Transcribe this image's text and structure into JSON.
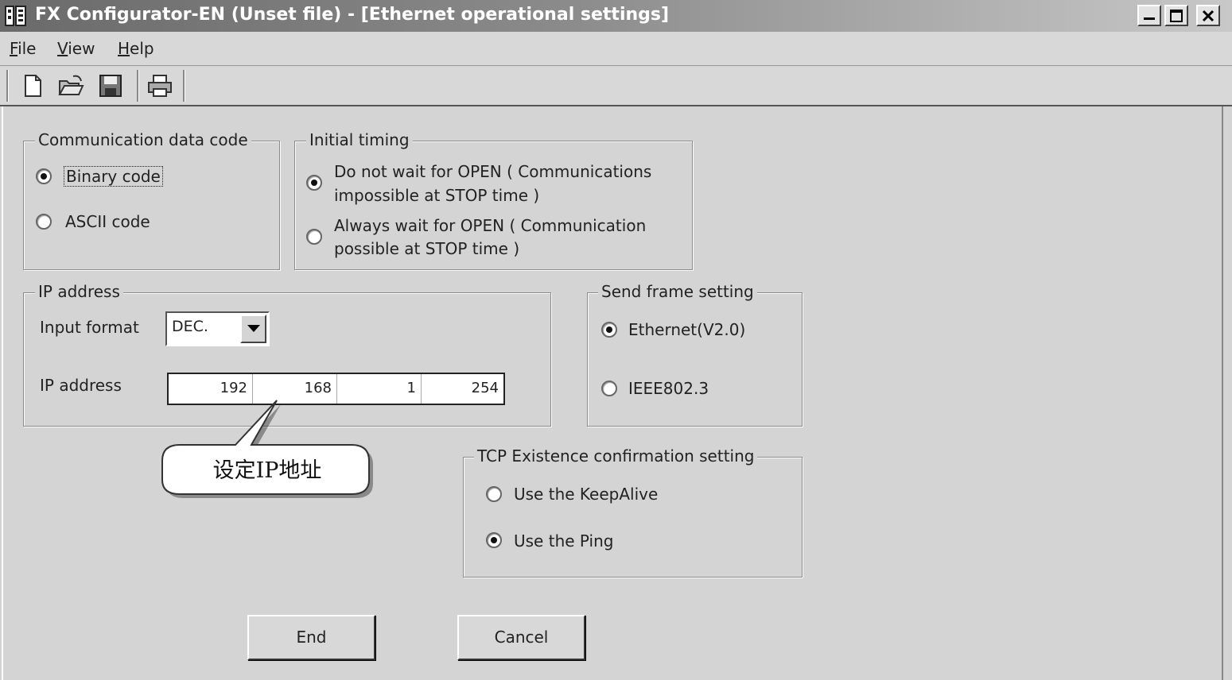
{
  "window": {
    "title": "FX Configurator-EN (Unset file) - [Ethernet operational settings]"
  },
  "menu": {
    "file": "File",
    "view": "View",
    "help": "Help"
  },
  "toolbar": {
    "icons": [
      "new-file-icon",
      "open-folder-icon",
      "save-disk-icon",
      "print-icon"
    ]
  },
  "comm_code": {
    "legend": "Communication data code",
    "binary": "Binary code",
    "ascii": "ASCII code",
    "selected": "binary"
  },
  "initial_timing": {
    "legend": "Initial timing",
    "opt1_line1": "Do not wait for OPEN ( Communications",
    "opt1_line2": "impossible at STOP time )",
    "opt2_line1": "Always wait for OPEN ( Communication",
    "opt2_line2": "possible at STOP time )",
    "selected": "opt1"
  },
  "ip": {
    "legend": "IP address",
    "input_format_label": "Input format",
    "input_format_value": "DEC.",
    "ip_label": "IP address",
    "octets": [
      "192",
      "168",
      "1",
      "254"
    ]
  },
  "callout": {
    "text": "设定IP地址"
  },
  "send_frame": {
    "legend": "Send frame setting",
    "ethernet": "Ethernet(V2.0)",
    "ieee": "IEEE802.3",
    "selected": "ethernet"
  },
  "tcp": {
    "legend": "TCP Existence confirmation setting",
    "keepalive": "Use the KeepAlive",
    "ping": "Use the Ping",
    "selected": "ping"
  },
  "buttons": {
    "end": "End",
    "cancel": "Cancel"
  }
}
